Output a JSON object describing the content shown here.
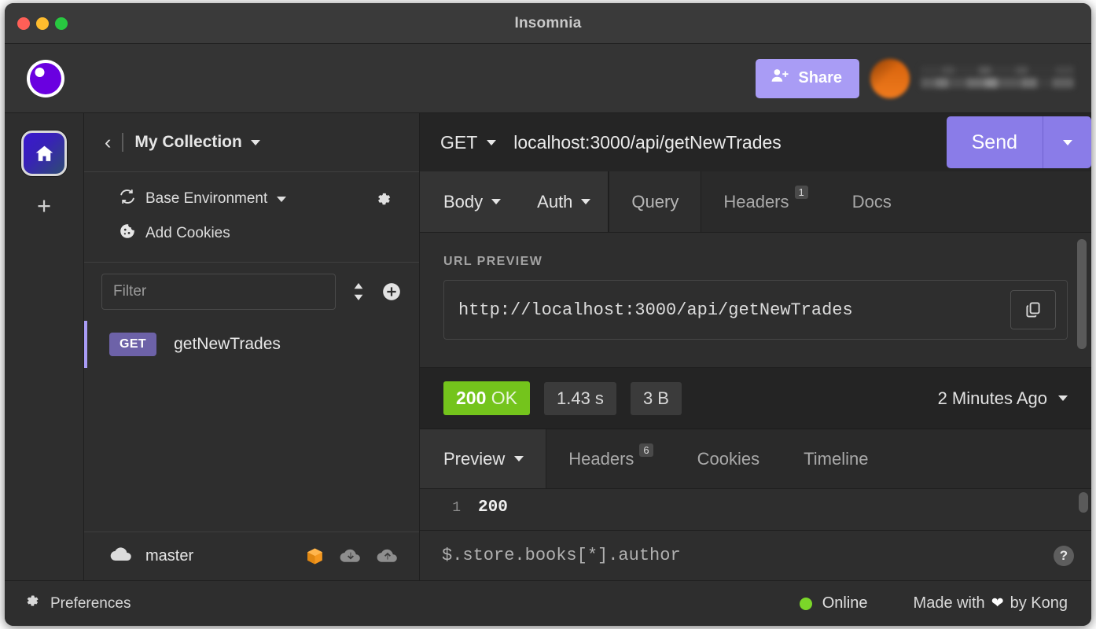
{
  "window": {
    "title": "Insomnia",
    "traffic_lights": [
      "close",
      "minimize",
      "maximize"
    ]
  },
  "header": {
    "logo_icon": "insomnia-logo-icon",
    "share_label": "Share",
    "share_icon": "person-add-icon",
    "share_bg": "#a99cf5",
    "avatar_color": "#e2690f",
    "username_redacted": true
  },
  "rail": {
    "home_icon": "home-icon",
    "add_icon": "plus-icon"
  },
  "sidebar": {
    "back_icon": "chevron-left-icon",
    "collection_name": "My Collection",
    "environment": {
      "icon": "refresh-icon",
      "label": "Base Environment",
      "settings_icon": "gear-icon"
    },
    "cookies": {
      "icon": "cookie-icon",
      "label": "Add Cookies"
    },
    "filter": {
      "placeholder": "Filter",
      "value": "",
      "sort_icon": "sort-updown-icon",
      "add_icon": "plus-circle-icon"
    },
    "requests": [
      {
        "method": "GET",
        "name": "getNewTrades",
        "selected": true
      }
    ],
    "sync": {
      "cloud_icon": "cloud-icon",
      "branch": "master",
      "box_icon": "package-icon",
      "box_color": "#f5981f",
      "pull_icon": "cloud-download-icon",
      "push_icon": "cloud-upload-icon"
    }
  },
  "request": {
    "method": "GET",
    "url": "localhost:3000/api/getNewTrades",
    "send_label": "Send",
    "send_dropdown_icon": "chevron-down-icon",
    "tabs": [
      {
        "label": "Body",
        "dropdown": true,
        "active": false
      },
      {
        "label": "Auth",
        "dropdown": true,
        "active": false
      },
      {
        "label": "Query",
        "dropdown": false,
        "active": true
      },
      {
        "label": "Headers",
        "dropdown": false,
        "active": false,
        "badge": "1"
      },
      {
        "label": "Docs",
        "dropdown": false,
        "active": false
      }
    ],
    "url_preview_label": "URL PREVIEW",
    "url_preview_value": "http://localhost:3000/api/getNewTrades",
    "copy_icon": "copy-icon"
  },
  "response": {
    "status_code": "200",
    "status_text": "OK",
    "status_color": "#74c41c",
    "time": "1.43 s",
    "size": "3 B",
    "age": "2 Minutes Ago",
    "age_dropdown_icon": "chevron-down-icon",
    "tabs": [
      {
        "label": "Preview",
        "dropdown": true,
        "active": true
      },
      {
        "label": "Headers",
        "dropdown": false,
        "active": false,
        "badge": "6"
      },
      {
        "label": "Cookies",
        "dropdown": false,
        "active": false
      },
      {
        "label": "Timeline",
        "dropdown": false,
        "active": false
      }
    ],
    "body_lines": [
      {
        "number": "1",
        "text": "200"
      }
    ],
    "jsonpath_placeholder": "$.store.books[*].author",
    "jsonpath_value": "",
    "help_label": "?"
  },
  "statusbar": {
    "preferences_label": "Preferences",
    "preferences_icon": "gear-icon",
    "online_label": "Online",
    "online_color": "#7bd629",
    "made_with_prefix": "Made with",
    "made_with_icon": "heart-icon",
    "made_with_suffix": "by Kong"
  }
}
